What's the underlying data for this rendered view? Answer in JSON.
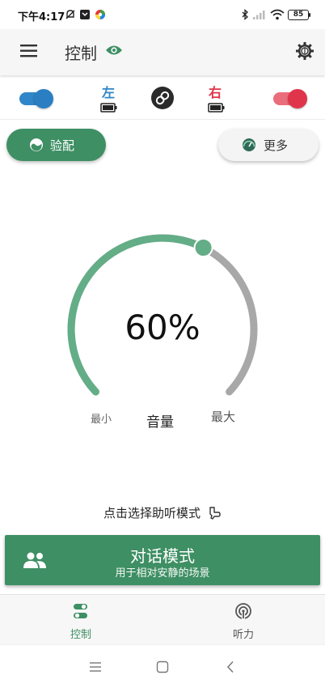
{
  "status_bar": {
    "time": "下午4:17",
    "battery": "85"
  },
  "app_bar": {
    "title": "控制"
  },
  "ear_row": {
    "left_label": "左",
    "right_label": "右",
    "left_color": "#2f86c8",
    "right_color": "#e0344a"
  },
  "actions": {
    "fitting_label": "验配",
    "more_label": "更多"
  },
  "volume": {
    "value_text": "60%",
    "level": 0.6,
    "min_label": "最小",
    "max_label": "最大",
    "title": "音量",
    "accent": "#63ad87",
    "track": "#a8a8a8"
  },
  "mode_section": {
    "hint": "点击选择助听模式",
    "mode_title": "对话模式",
    "mode_subtitle": "用于相对安静的场景",
    "card_color": "#3e8f64"
  },
  "bottom_nav": {
    "control_label": "控制",
    "hearing_label": "听力",
    "active_color": "#3e8f64"
  }
}
